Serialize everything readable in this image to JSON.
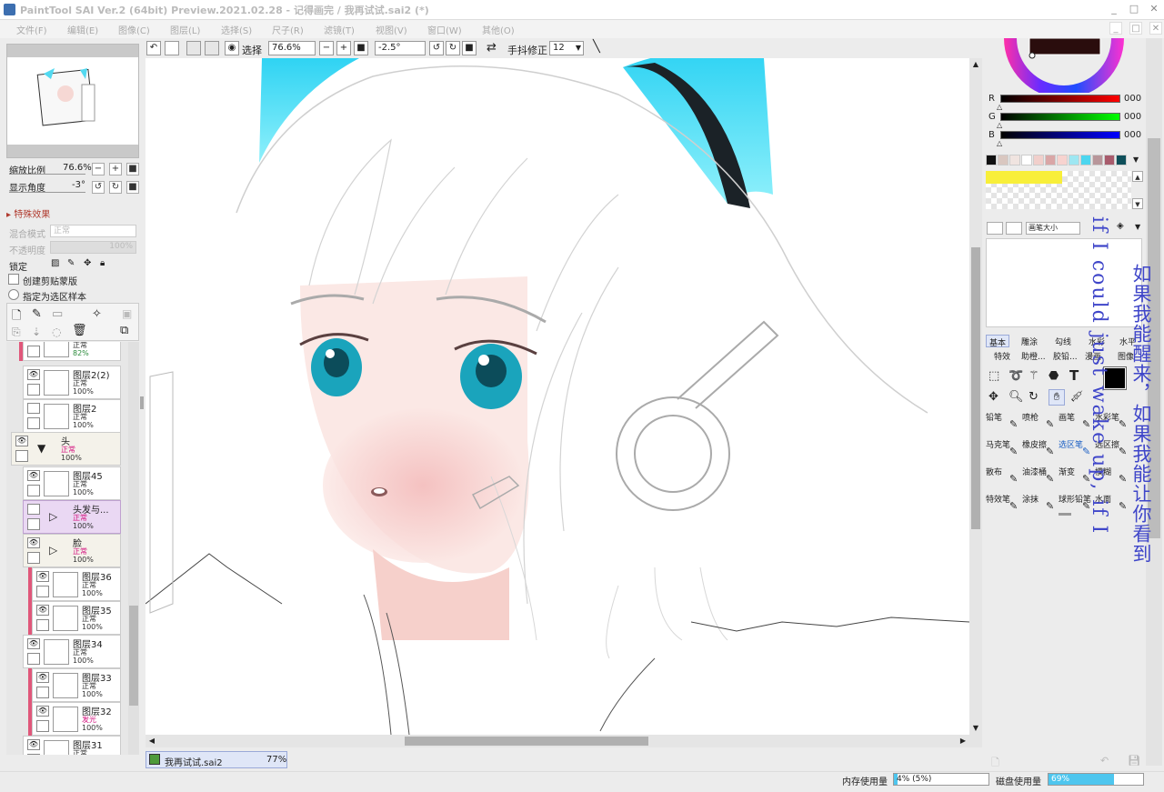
{
  "title": "PaintTool SAI Ver.2 (64bit) Preview.2021.02.28 - 记得画完 / 我再试试.sai2 (*)",
  "menu": [
    "文件(F)",
    "编辑(E)",
    "图像(C)",
    "图层(L)",
    "选择(S)",
    "尺子(R)",
    "滤镜(T)",
    "视图(V)",
    "窗口(W)",
    "其他(O)"
  ],
  "nav": {
    "zoom_label": "缩放比例",
    "zoom_value": "76.6%",
    "angle_label": "显示角度",
    "angle_value": "-3°"
  },
  "effects_label": "特殊效果",
  "layer_props": {
    "blend_label": "混合模式",
    "blend_value": "正常",
    "opacity_label": "不透明度",
    "opacity_value": "100%",
    "lock_label": "锁定",
    "clip_label": "创建剪贴蒙版",
    "sample_label": "指定为选区样本"
  },
  "layers": [
    {
      "name": "",
      "mode": "正常",
      "opacity": "82%"
    },
    {
      "name": "图层2(2)",
      "mode": "正常",
      "opacity": "100%"
    },
    {
      "name": "图层2",
      "mode": "正常",
      "opacity": "100%"
    },
    {
      "name": "头",
      "mode": "正常",
      "opacity": "100%"
    },
    {
      "name": "图层45",
      "mode": "正常",
      "opacity": "100%"
    },
    {
      "name": "头发与...",
      "mode": "正常",
      "opacity": "100%"
    },
    {
      "name": "脸",
      "mode": "正常",
      "opacity": "100%"
    },
    {
      "name": "图层36",
      "mode": "正常",
      "opacity": "100%"
    },
    {
      "name": "图层35",
      "mode": "正常",
      "opacity": "100%"
    },
    {
      "name": "图层34",
      "mode": "正常",
      "opacity": "100%"
    },
    {
      "name": "图层33",
      "mode": "正常",
      "opacity": "100%"
    },
    {
      "name": "图层32",
      "mode": "发光",
      "opacity": "100%"
    },
    {
      "name": "图层31",
      "mode": "正常",
      "opacity": ""
    }
  ],
  "toolbar": {
    "select_label": "选择",
    "zoom": "76.6%",
    "rotate": "-2.5°",
    "stabilizer_label": "手抖修正",
    "stabilizer_value": "12"
  },
  "color": {
    "r_label": "R",
    "g_label": "G",
    "b_label": "B",
    "r": "000",
    "g": "000",
    "b": "000",
    "r_level": 0,
    "g_level": 0,
    "b_level": 0
  },
  "swatches": [
    "#111111",
    "#d9c7c0",
    "#f0e4e0",
    "#ffffff",
    "#f1cfcb",
    "#d9a6a6",
    "#f7d3cf",
    "#9ee7f2",
    "#4cd6ef",
    "#b8969a",
    "#a85b6c",
    "#0e4f5a"
  ],
  "brush_size_label": "画笔大小",
  "tool_tabs": [
    "基本",
    "雕涂",
    "勾线",
    "水彩",
    "水平"
  ],
  "tool_tabs2": [
    "特效",
    "助橙...",
    "胶铅...",
    "漫画",
    "图像"
  ],
  "brushes": [
    [
      "铅笔",
      "喷枪",
      "画笔",
      "水彩笔"
    ],
    [
      "马克笔",
      "橡皮擦",
      "选区笔",
      "选区擦"
    ],
    [
      "散布",
      "油漆桶",
      "渐变",
      "模糊"
    ],
    [
      "特效笔",
      "涂抹",
      "球形铅笔",
      "水面"
    ]
  ],
  "doc_tab": {
    "name": "我再试试.sai2",
    "zoom": "77%"
  },
  "status": {
    "mem_label": "内存使用量",
    "mem_value": "4% (5%)",
    "mem_level": 0.04,
    "disk_label": "磁盘使用量",
    "disk_value": "69%",
    "disk_level": 0.69
  },
  "overlay": {
    "cn": "如果我能醒来，如果我能让你看到",
    "en": "if I could just wake up, if I"
  }
}
